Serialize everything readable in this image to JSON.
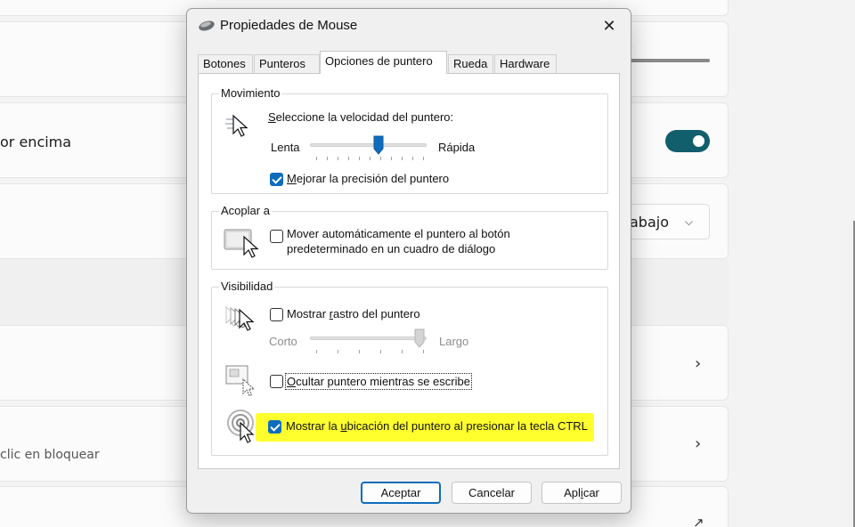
{
  "background": {
    "row_hover_label": "or encima",
    "dropdown_value": "abajo",
    "dropdown_chevron": "⌵",
    "row_lock_subtext": "clic en bloquear",
    "chevron_glyph": "›",
    "external_glyph": "↗",
    "toggle_on": true,
    "accent_color": "#115e6c"
  },
  "dialog": {
    "title": "Propiedades de Mouse",
    "close_glyph": "✕",
    "tabs": [
      {
        "label": "Botones"
      },
      {
        "label": "Punteros"
      },
      {
        "label": "Opciones de puntero",
        "active": true
      },
      {
        "label": "Rueda"
      },
      {
        "label": "Hardware"
      }
    ],
    "movement": {
      "legend": "Movimiento",
      "speed_label": "Seleccione la velocidad del puntero:",
      "slow": "Lenta",
      "fast": "Rápida",
      "speed_value": 0.6,
      "enhance_precision": "Mejorar la precisión del puntero",
      "enhance_precision_checked": true
    },
    "snap": {
      "legend": "Acoplar a",
      "line1": "Mover automáticamente el puntero al botón",
      "line2": "predeterminado en un cuadro de diálogo",
      "checked": false
    },
    "visibility": {
      "legend": "Visibilidad",
      "trails_label": "Mostrar rastro del puntero",
      "trails_checked": false,
      "short": "Corto",
      "long": "Largo",
      "trail_length": 1.0,
      "hide_typing": "Ocultar puntero mientras se escribe",
      "hide_typing_checked": false,
      "show_location": "Mostrar la ubicación del puntero al presionar la tecla CTRL",
      "show_location_checked": true,
      "highlight_color": "#ffff2e"
    },
    "buttons": {
      "accept": "Aceptar",
      "cancel": "Cancelar",
      "apply": "Aplicar"
    },
    "check_color": "#0f6cbd"
  }
}
